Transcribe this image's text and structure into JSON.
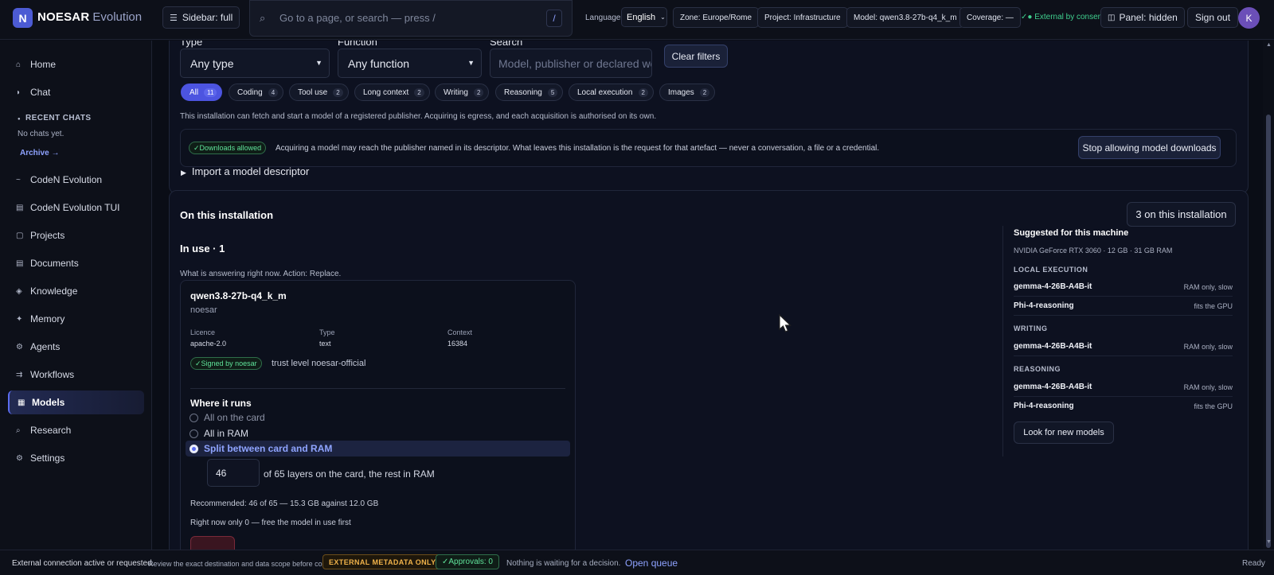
{
  "header": {
    "logo_letter": "N",
    "brand": "NOESAR",
    "brand_sub": "Evolution",
    "sidebar_toggle": "Sidebar: full",
    "search_placeholder": "Go to a page, or search — press /",
    "search_key": "/",
    "language_label": "Language",
    "language_value": "English",
    "zone": "Zone: Europe/Rome",
    "project": "Project: Infrastructure",
    "model": "Model: qwen3.8-27b-q4_k_m",
    "coverage": "Coverage: —",
    "external": "✓● External by consent",
    "panel": "Panel: hidden",
    "sign_out": "Sign out",
    "avatar": "K"
  },
  "sidebar": {
    "top_items": [
      {
        "icon": "⌂",
        "label": "Home"
      },
      {
        "icon": "◗",
        "label": "Chat"
      }
    ],
    "recent_title": "RECENT CHATS",
    "no_chats": "No chats yet.",
    "archive": "Archive →",
    "items": [
      {
        "icon": "~",
        "label": "CodeN Evolution"
      },
      {
        "icon": "▤",
        "label": "CodeN Evolution TUI"
      },
      {
        "icon": "▢",
        "label": "Projects"
      },
      {
        "icon": "▤",
        "label": "Documents"
      },
      {
        "icon": "◈",
        "label": "Knowledge"
      },
      {
        "icon": "✦",
        "label": "Memory"
      },
      {
        "icon": "⚙",
        "label": "Agents"
      },
      {
        "icon": "⇉",
        "label": "Workflows"
      },
      {
        "icon": "▦",
        "label": "Models"
      },
      {
        "icon": "⌕",
        "label": "Research"
      },
      {
        "icon": "⚙",
        "label": "Settings"
      }
    ]
  },
  "filters": {
    "type_label": "Type",
    "type_value": "Any type",
    "function_label": "Function",
    "function_value": "Any function",
    "search_label": "Search",
    "search_placeholder": "Model, publisher or declared wo",
    "clear": "Clear filters",
    "pills": [
      {
        "label": "All",
        "count": "11"
      },
      {
        "label": "Coding",
        "count": "4"
      },
      {
        "label": "Tool use",
        "count": "2"
      },
      {
        "label": "Long context",
        "count": "2"
      },
      {
        "label": "Writing",
        "count": "2"
      },
      {
        "label": "Reasoning",
        "count": "5"
      },
      {
        "label": "Local execution",
        "count": "2"
      },
      {
        "label": "Images",
        "count": "2"
      }
    ],
    "egress_note": "This installation can fetch and start a model of a registered publisher. Acquiring is egress, and each acquisition is authorised on its own.",
    "downloads_badge": "✓Downloads allowed",
    "downloads_text": "Acquiring a model may reach the publisher named in its descriptor. What leaves this installation is the request for that artefact — never a conversation, a file or a credential.",
    "stop_downloads": "Stop allowing model downloads",
    "import": "Import a model descriptor"
  },
  "installation": {
    "title": "On this installation",
    "count_badge": "3 on this installation",
    "in_use_title": "In use · 1",
    "in_use_note": "What is answering right now. Action: Replace.",
    "model_name": "qwen3.8-27b-q4_k_m",
    "publisher": "noesar",
    "licence_label": "Licence",
    "licence": "apache-2.0",
    "type_label": "Type",
    "type": "text",
    "context_label": "Context",
    "context": "16384",
    "signed_badge": "✓Signed by noesar",
    "trust": "trust level noesar-official",
    "where_title": "Where it runs",
    "options": [
      "All on the card",
      "All in RAM",
      "Split between card and RAM"
    ],
    "layers_value": "46",
    "layers_text": "of 65 layers on the card, the rest in RAM",
    "recommended": "Recommended: 46 of 65 — 15.3 GB against 12.0 GB",
    "right_now": "Right now only 0 — free the model in use first"
  },
  "suggested": {
    "title": "Suggested for this machine",
    "machine": "NVIDIA GeForce RTX 3060 · 12 GB · 31 GB RAM",
    "categories": [
      {
        "name": "LOCAL EXECUTION",
        "rows": [
          {
            "model": "gemma-4-26B-A4B-it",
            "hint": "RAM only, slow"
          },
          {
            "model": "Phi-4-reasoning",
            "hint": "fits the GPU"
          }
        ]
      },
      {
        "name": "WRITING",
        "rows": [
          {
            "model": "gemma-4-26B-A4B-it",
            "hint": "RAM only, slow"
          }
        ]
      },
      {
        "name": "REASONING",
        "rows": [
          {
            "model": "gemma-4-26B-A4B-it",
            "hint": "RAM only, slow"
          },
          {
            "model": "Phi-4-reasoning",
            "hint": "fits the GPU"
          }
        ]
      }
    ],
    "look_button": "Look for new models"
  },
  "status": {
    "external": "External connection active or requested.",
    "review": "Review the exact destination and data scope before continuing.",
    "meta": "EXTERNAL METADATA ONLY",
    "approvals": "✓Approvals: 0",
    "waiting": "Nothing is waiting for a decision.",
    "open_queue": "Open queue",
    "ready": "Ready"
  },
  "colors": {
    "accent": "#4c54e0",
    "success": "#3fcf8e",
    "warning": "#f0b24a",
    "link": "#8ea2ff"
  }
}
